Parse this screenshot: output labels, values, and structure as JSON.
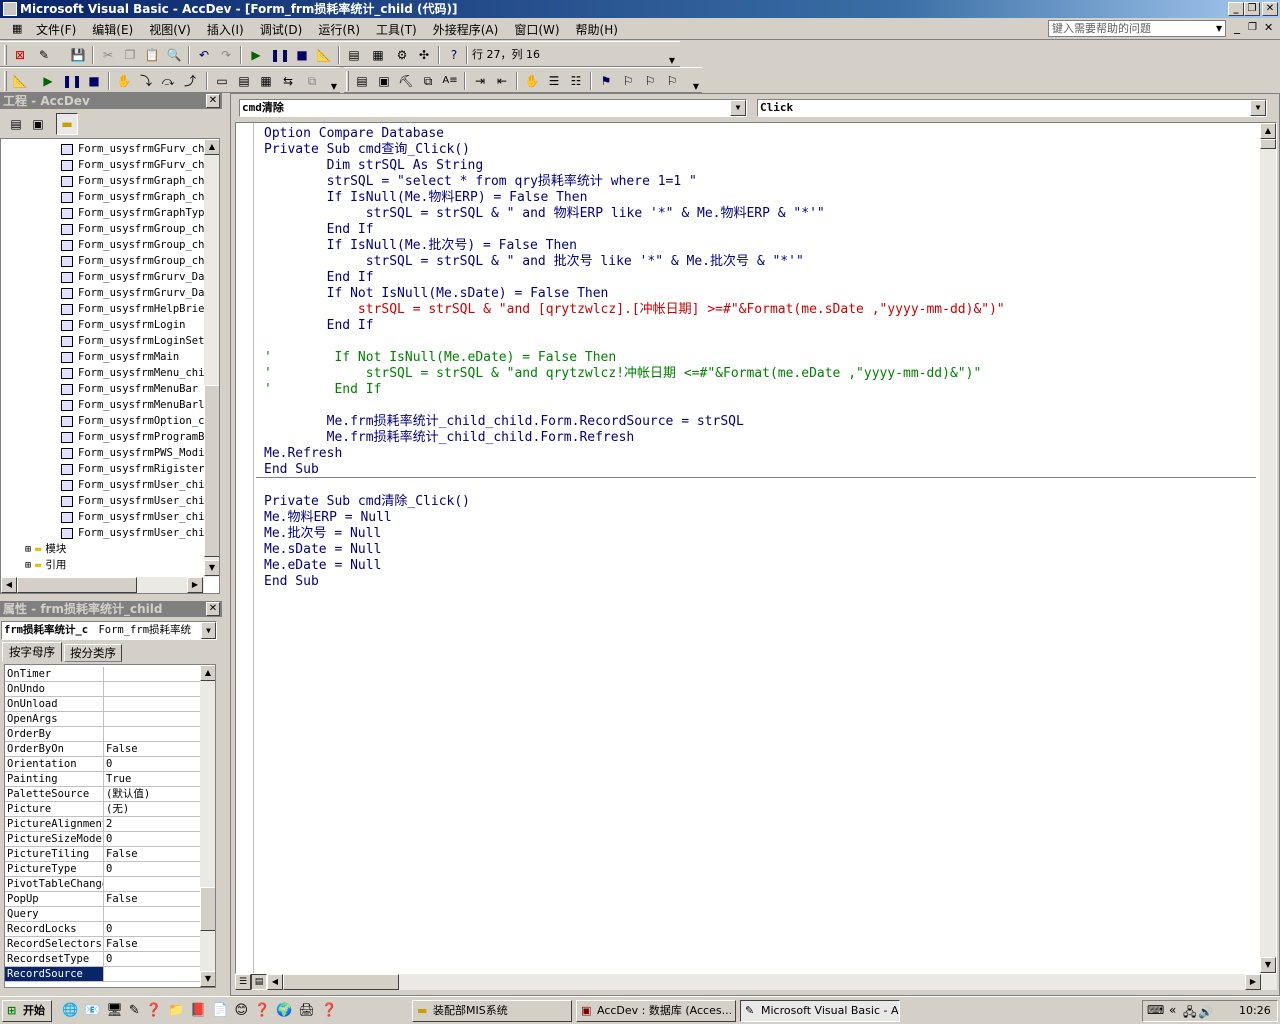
{
  "window": {
    "title": "Microsoft Visual Basic - AccDev - [Form_frm损耗率统计_child (代码)]"
  },
  "menu": {
    "items": [
      "文件(F)",
      "编辑(E)",
      "视图(V)",
      "插入(I)",
      "调试(D)",
      "运行(R)",
      "工具(T)",
      "外接程序(A)",
      "窗口(W)",
      "帮助(H)"
    ],
    "help_placeholder": "键入需要帮助的问题"
  },
  "toolbar": {
    "position": "行 27，列 16"
  },
  "project": {
    "title": "工程 - AccDev",
    "items": [
      "Form_usysfrmGFurv_chi",
      "Form_usysfrmGFurv_chi",
      "Form_usysfrmGraph_chi",
      "Form_usysfrmGraph_chi",
      "Form_usysfrmGraphType",
      "Form_usysfrmGroup_chi",
      "Form_usysfrmGroup_chi",
      "Form_usysfrmGroup_chi",
      "Form_usysfrmGrurv_Dat",
      "Form_usysfrmGrurv_Dat",
      "Form_usysfrmHelpBrief",
      "Form_usysfrmLogin",
      "Form_usysfrmLoginSet",
      "Form_usysfrmMain",
      "Form_usysfrmMenu_chil",
      "Form_usysfrmMenuBar",
      "Form_usysfrmMenuBarli",
      "Form_usysfrmOption_ch",
      "Form_usysfrmProgramBa",
      "Form_usysfrmPWS_Modif",
      "Form_usysfrmRigister",
      "Form_usysfrmUser_chil",
      "Form_usysfrmUser_chil",
      "Form_usysfrmUser_chil",
      "Form_usysfrmUser_chil"
    ],
    "folders": [
      "模块",
      "引用"
    ]
  },
  "properties": {
    "title": "属性 - frm损耗率统计_child",
    "object_name": "frm损耗率统计_c",
    "object_type": "Form_frm损耗率统",
    "tabs": [
      "按字母序",
      "按分类序"
    ],
    "rows": [
      [
        "OnTimer",
        ""
      ],
      [
        "OnUndo",
        ""
      ],
      [
        "OnUnload",
        ""
      ],
      [
        "OpenArgs",
        ""
      ],
      [
        "OrderBy",
        ""
      ],
      [
        "OrderByOn",
        "False"
      ],
      [
        "Orientation",
        "0"
      ],
      [
        "Painting",
        "True"
      ],
      [
        "PaletteSource",
        "(默认值)"
      ],
      [
        "Picture",
        "(无)"
      ],
      [
        "PictureAlignment",
        "2"
      ],
      [
        "PictureSizeMode",
        "0"
      ],
      [
        "PictureTiling",
        "False"
      ],
      [
        "PictureType",
        "0"
      ],
      [
        "PivotTableChange",
        ""
      ],
      [
        "PopUp",
        "False"
      ],
      [
        "Query",
        ""
      ],
      [
        "RecordLocks",
        "0"
      ],
      [
        "RecordSelectors",
        "False"
      ],
      [
        "RecordsetType",
        "0"
      ],
      [
        "RecordSource",
        ""
      ]
    ]
  },
  "code": {
    "object_combo": "cmd清除",
    "proc_combo": "Click",
    "lines1": [
      {
        "t": "Option Compare Database",
        "c": "#000080"
      },
      {
        "t": "Private Sub cmd查询_Click()",
        "c": "#000080"
      },
      {
        "t": "        Dim strSQL As String",
        "c": "#000080"
      },
      {
        "t": "        strSQL = \"select * from qry损耗率统计 where 1=1 \"",
        "c": "#000080"
      },
      {
        "t": "        If IsNull(Me.物料ERP) = False Then",
        "c": "#000080"
      },
      {
        "t": "             strSQL = strSQL & \" and 物料ERP like '*\" & Me.物料ERP & \"*'\"",
        "c": "#000080"
      },
      {
        "t": "        End If",
        "c": "#000080"
      },
      {
        "t": "        If IsNull(Me.批次号) = False Then",
        "c": "#000080"
      },
      {
        "t": "             strSQL = strSQL & \" and 批次号 like '*\" & Me.批次号 & \"*'\"",
        "c": "#000080"
      },
      {
        "t": "        End If",
        "c": "#000080"
      },
      {
        "t": "        If Not IsNull(Me.sDate) = False Then",
        "c": "#000080"
      },
      {
        "t": "            strSQL = strSQL & \"and [qrytzwlcz].[冲帐日期] >=#\"&Format(me.sDate ,\"yyyy-mm-dd)&\")\"",
        "c": "#d00000"
      },
      {
        "t": "        End If",
        "c": "#000080"
      },
      {
        "t": "",
        "c": "#000080"
      },
      {
        "t": "'        If Not IsNull(Me.eDate) = False Then",
        "c": "#008000"
      },
      {
        "t": "'            strSQL = strSQL & \"and qrytzwlcz!冲帐日期 <=#\"&Format(me.eDate ,\"yyyy-mm-dd)&\")\"",
        "c": "#008000"
      },
      {
        "t": "'        End If",
        "c": "#008000"
      },
      {
        "t": "",
        "c": "#000080"
      },
      {
        "t": "        Me.frm损耗率统计_child_child.Form.RecordSource = strSQL",
        "c": "#000080"
      },
      {
        "t": "        Me.frm损耗率统计_child_child.Form.Refresh",
        "c": "#000080"
      },
      {
        "t": "Me.Refresh",
        "c": "#000080"
      },
      {
        "t": "End Sub",
        "c": "#000080"
      }
    ],
    "lines2": [
      {
        "t": "Private Sub cmd清除_Click()",
        "c": "#000080"
      },
      {
        "t": "Me.物料ERP = Null",
        "c": "#000080"
      },
      {
        "t": "Me.批次号 = Null",
        "c": "#000080"
      },
      {
        "t": "Me.sDate = Null",
        "c": "#000080"
      },
      {
        "t": "Me.eDate = Null",
        "c": "#000080"
      },
      {
        "t": "End Sub",
        "c": "#000080"
      }
    ]
  },
  "taskbar": {
    "start": "开始",
    "buttons": [
      "装配部MIS系统",
      "AccDev : 数据库 (Acces...",
      "Microsoft Visual Basic - A..."
    ],
    "clock": "10:26"
  }
}
